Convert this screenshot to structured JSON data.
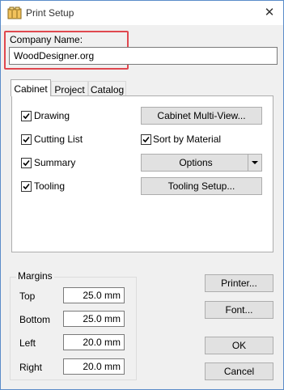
{
  "window": {
    "title": "Print Setup",
    "close_symbol": "✕"
  },
  "company": {
    "label": "Company Name:",
    "value": "WoodDesigner.org"
  },
  "tabs": [
    "Cabinet",
    "Project",
    "Catalog"
  ],
  "options": {
    "drawing": {
      "label": "Drawing",
      "checked": true
    },
    "cutting_list": {
      "label": "Cutting List",
      "checked": true
    },
    "summary": {
      "label": "Summary",
      "checked": true
    },
    "tooling": {
      "label": "Tooling",
      "checked": true
    },
    "sort_by_material": {
      "label": "Sort by Material",
      "checked": true
    }
  },
  "buttons": {
    "cabinet_multiview": "Cabinet Multi-View...",
    "options": "Options",
    "tooling_setup": "Tooling Setup...",
    "printer": "Printer...",
    "font": "Font...",
    "ok": "OK",
    "cancel": "Cancel"
  },
  "margins": {
    "title": "Margins",
    "top": {
      "label": "Top",
      "value": "25.0 mm"
    },
    "bottom": {
      "label": "Bottom",
      "value": "25.0 mm"
    },
    "left": {
      "label": "Left",
      "value": "20.0 mm"
    },
    "right": {
      "label": "Right",
      "value": "20.0 mm"
    }
  }
}
